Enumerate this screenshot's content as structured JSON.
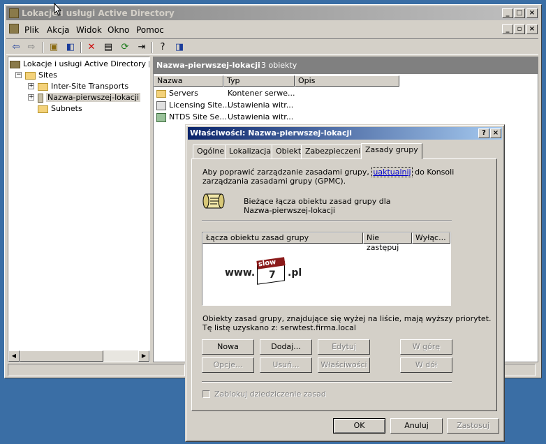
{
  "main_window": {
    "title": "Lokacje i usługi Active Directory",
    "menu": [
      "Plik",
      "Akcja",
      "Widok",
      "Okno",
      "Pomoc"
    ]
  },
  "tree": {
    "root": "Lokacje i usługi Active Directory [serw",
    "sites": "Sites",
    "inter_site": "Inter-Site Transports",
    "site": "Nazwa-pierwszej-lokacji",
    "subnets": "Subnets"
  },
  "right_pane": {
    "title": "Nazwa-pierwszej-lokacji",
    "count": "3 obiekty",
    "columns": [
      "Nazwa",
      "Typ",
      "Opis"
    ],
    "rows": [
      {
        "name": "Servers",
        "type": "Kontener serwe..."
      },
      {
        "name": "Licensing Site...",
        "type": "Ustawienia witr..."
      },
      {
        "name": "NTDS Site Se...",
        "type": "Ustawienia witr..."
      }
    ]
  },
  "dialog": {
    "title": "Właściwości: Nazwa-pierwszej-lokacji",
    "tabs": [
      "Ogólne",
      "Lokalizacja",
      "Obiekt",
      "Zabezpieczenia",
      "Zasady grupy"
    ],
    "active_tab": "Zasady grupy",
    "intro_a": "Aby poprawić zarządzanie zasadami grupy,",
    "intro_link": "uaktualnij",
    "intro_b": "do Konsoli",
    "intro_c": "zarządzania zasadami grupy (GPMC).",
    "current_links_1": "Bieżące łącza obiektu zasad grupy dla",
    "current_links_2": "Nazwa-pierwszej-lokacji",
    "list_columns": [
      "Łącza obiektu zasad grupy",
      "Nie zastępuj",
      "Wyłąc..."
    ],
    "watermark_www": "www.",
    "watermark_slow": "slow",
    "watermark_seven": "7",
    "watermark_pl": ".pl",
    "priority_note": "Obiekty zasad grupy, znajdujące się wyżej na liście, mają wyższy priorytet.",
    "source_note": "Tę listę uzyskano z: serwtest.firma.local",
    "buttons": {
      "new": "Nowa",
      "add": "Dodaj...",
      "edit": "Edytuj",
      "up": "W górę",
      "options": "Opcje...",
      "delete": "Usuń...",
      "properties": "Właściwości",
      "down": "W dół"
    },
    "block_inheritance": "Zablokuj dziedziczenie zasad",
    "ok": "OK",
    "cancel": "Anuluj",
    "apply": "Zastosuj"
  }
}
